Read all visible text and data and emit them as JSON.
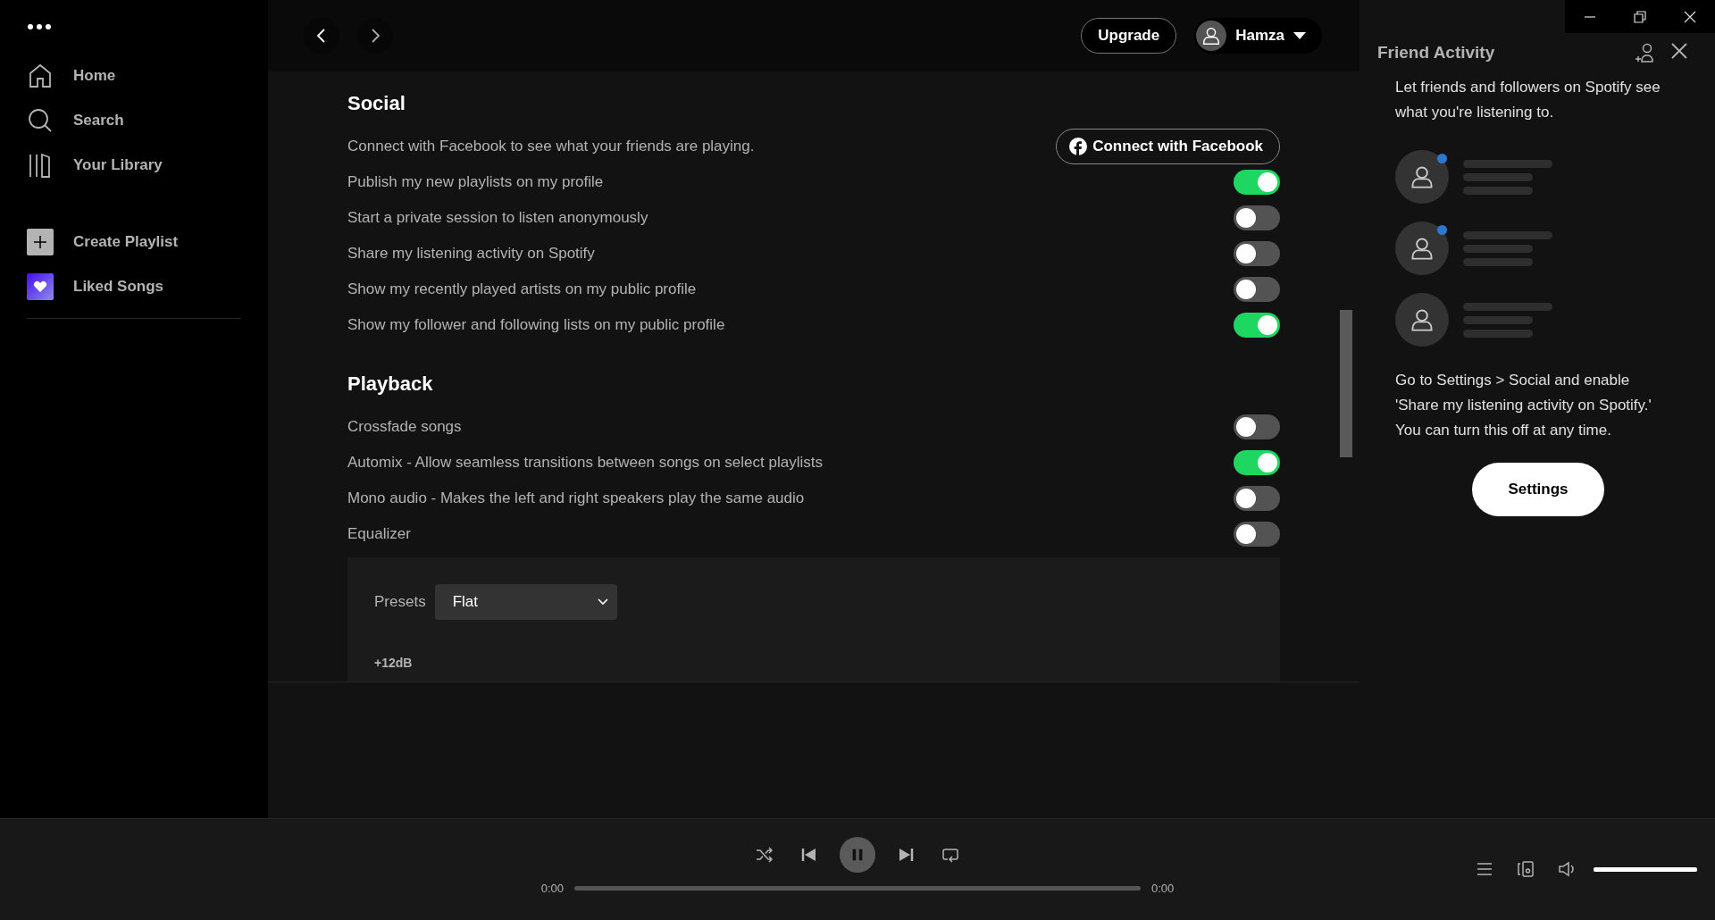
{
  "sidebar": {
    "items": [
      {
        "label": "Home"
      },
      {
        "label": "Search"
      },
      {
        "label": "Your Library"
      }
    ],
    "actions": [
      {
        "label": "Create Playlist",
        "kind": "create"
      },
      {
        "label": "Liked Songs",
        "kind": "liked"
      }
    ]
  },
  "topbar": {
    "upgrade": "Upgrade",
    "user": "Hamza"
  },
  "sections": [
    {
      "title": "Social",
      "rows": [
        {
          "kind": "facebook",
          "label": "Connect with Facebook to see what your friends are playing.",
          "button": "Connect with Facebook"
        },
        {
          "kind": "toggle",
          "label": "Publish my new playlists on my profile",
          "on": true
        },
        {
          "kind": "toggle",
          "label": "Start a private session to listen anonymously",
          "on": false
        },
        {
          "kind": "toggle",
          "label": "Share my listening activity on Spotify",
          "on": false
        },
        {
          "kind": "toggle",
          "label": "Show my recently played artists on my public profile",
          "on": false
        },
        {
          "kind": "toggle",
          "label": "Show my follower and following lists on my public profile",
          "on": true
        }
      ]
    },
    {
      "title": "Playback",
      "rows": [
        {
          "kind": "toggle",
          "label": "Crossfade songs",
          "on": false
        },
        {
          "kind": "toggle",
          "label": "Automix - Allow seamless transitions between songs on select playlists",
          "on": true
        },
        {
          "kind": "toggle",
          "label": "Mono audio - Makes the left and right speakers play the same audio",
          "on": false
        },
        {
          "kind": "toggle",
          "label": "Equalizer",
          "on": false
        }
      ]
    }
  ],
  "equalizer": {
    "presets_label": "Presets",
    "preset": "Flat",
    "axis_label": "+12dB"
  },
  "friend_activity": {
    "title": "Friend Activity",
    "intro": "Let friends and followers on Spotify see what you're listening to.",
    "friends": [
      {
        "online": true
      },
      {
        "online": true
      },
      {
        "online": false
      }
    ],
    "hint": "Go to Settings > Social and enable 'Share my listening activity on Spotify.' You can turn this off at any time.",
    "button": "Settings"
  },
  "player": {
    "elapsed": "0:00",
    "duration": "0:00",
    "progress": {
      "level": 0
    },
    "volume": {
      "level": 1
    }
  }
}
